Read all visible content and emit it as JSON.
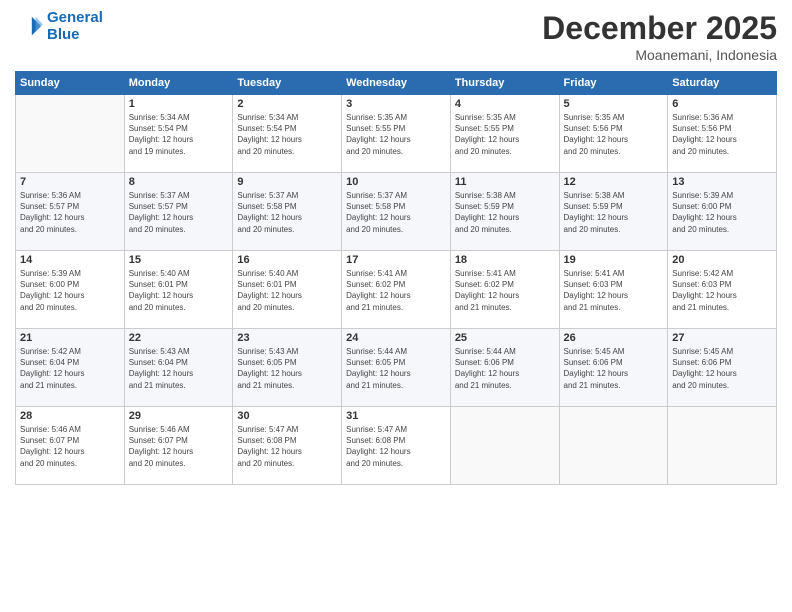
{
  "header": {
    "logo_line1": "General",
    "logo_line2": "Blue",
    "month": "December 2025",
    "location": "Moanemani, Indonesia"
  },
  "weekdays": [
    "Sunday",
    "Monday",
    "Tuesday",
    "Wednesday",
    "Thursday",
    "Friday",
    "Saturday"
  ],
  "weeks": [
    [
      {
        "day": "",
        "info": ""
      },
      {
        "day": "1",
        "info": "Sunrise: 5:34 AM\nSunset: 5:54 PM\nDaylight: 12 hours\nand 19 minutes."
      },
      {
        "day": "2",
        "info": "Sunrise: 5:34 AM\nSunset: 5:54 PM\nDaylight: 12 hours\nand 20 minutes."
      },
      {
        "day": "3",
        "info": "Sunrise: 5:35 AM\nSunset: 5:55 PM\nDaylight: 12 hours\nand 20 minutes."
      },
      {
        "day": "4",
        "info": "Sunrise: 5:35 AM\nSunset: 5:55 PM\nDaylight: 12 hours\nand 20 minutes."
      },
      {
        "day": "5",
        "info": "Sunrise: 5:35 AM\nSunset: 5:56 PM\nDaylight: 12 hours\nand 20 minutes."
      },
      {
        "day": "6",
        "info": "Sunrise: 5:36 AM\nSunset: 5:56 PM\nDaylight: 12 hours\nand 20 minutes."
      }
    ],
    [
      {
        "day": "7",
        "info": "Sunrise: 5:36 AM\nSunset: 5:57 PM\nDaylight: 12 hours\nand 20 minutes."
      },
      {
        "day": "8",
        "info": "Sunrise: 5:37 AM\nSunset: 5:57 PM\nDaylight: 12 hours\nand 20 minutes."
      },
      {
        "day": "9",
        "info": "Sunrise: 5:37 AM\nSunset: 5:58 PM\nDaylight: 12 hours\nand 20 minutes."
      },
      {
        "day": "10",
        "info": "Sunrise: 5:37 AM\nSunset: 5:58 PM\nDaylight: 12 hours\nand 20 minutes."
      },
      {
        "day": "11",
        "info": "Sunrise: 5:38 AM\nSunset: 5:59 PM\nDaylight: 12 hours\nand 20 minutes."
      },
      {
        "day": "12",
        "info": "Sunrise: 5:38 AM\nSunset: 5:59 PM\nDaylight: 12 hours\nand 20 minutes."
      },
      {
        "day": "13",
        "info": "Sunrise: 5:39 AM\nSunset: 6:00 PM\nDaylight: 12 hours\nand 20 minutes."
      }
    ],
    [
      {
        "day": "14",
        "info": "Sunrise: 5:39 AM\nSunset: 6:00 PM\nDaylight: 12 hours\nand 20 minutes."
      },
      {
        "day": "15",
        "info": "Sunrise: 5:40 AM\nSunset: 6:01 PM\nDaylight: 12 hours\nand 20 minutes."
      },
      {
        "day": "16",
        "info": "Sunrise: 5:40 AM\nSunset: 6:01 PM\nDaylight: 12 hours\nand 20 minutes."
      },
      {
        "day": "17",
        "info": "Sunrise: 5:41 AM\nSunset: 6:02 PM\nDaylight: 12 hours\nand 21 minutes."
      },
      {
        "day": "18",
        "info": "Sunrise: 5:41 AM\nSunset: 6:02 PM\nDaylight: 12 hours\nand 21 minutes."
      },
      {
        "day": "19",
        "info": "Sunrise: 5:41 AM\nSunset: 6:03 PM\nDaylight: 12 hours\nand 21 minutes."
      },
      {
        "day": "20",
        "info": "Sunrise: 5:42 AM\nSunset: 6:03 PM\nDaylight: 12 hours\nand 21 minutes."
      }
    ],
    [
      {
        "day": "21",
        "info": "Sunrise: 5:42 AM\nSunset: 6:04 PM\nDaylight: 12 hours\nand 21 minutes."
      },
      {
        "day": "22",
        "info": "Sunrise: 5:43 AM\nSunset: 6:04 PM\nDaylight: 12 hours\nand 21 minutes."
      },
      {
        "day": "23",
        "info": "Sunrise: 5:43 AM\nSunset: 6:05 PM\nDaylight: 12 hours\nand 21 minutes."
      },
      {
        "day": "24",
        "info": "Sunrise: 5:44 AM\nSunset: 6:05 PM\nDaylight: 12 hours\nand 21 minutes."
      },
      {
        "day": "25",
        "info": "Sunrise: 5:44 AM\nSunset: 6:06 PM\nDaylight: 12 hours\nand 21 minutes."
      },
      {
        "day": "26",
        "info": "Sunrise: 5:45 AM\nSunset: 6:06 PM\nDaylight: 12 hours\nand 21 minutes."
      },
      {
        "day": "27",
        "info": "Sunrise: 5:45 AM\nSunset: 6:06 PM\nDaylight: 12 hours\nand 20 minutes."
      }
    ],
    [
      {
        "day": "28",
        "info": "Sunrise: 5:46 AM\nSunset: 6:07 PM\nDaylight: 12 hours\nand 20 minutes."
      },
      {
        "day": "29",
        "info": "Sunrise: 5:46 AM\nSunset: 6:07 PM\nDaylight: 12 hours\nand 20 minutes."
      },
      {
        "day": "30",
        "info": "Sunrise: 5:47 AM\nSunset: 6:08 PM\nDaylight: 12 hours\nand 20 minutes."
      },
      {
        "day": "31",
        "info": "Sunrise: 5:47 AM\nSunset: 6:08 PM\nDaylight: 12 hours\nand 20 minutes."
      },
      {
        "day": "",
        "info": ""
      },
      {
        "day": "",
        "info": ""
      },
      {
        "day": "",
        "info": ""
      }
    ]
  ]
}
